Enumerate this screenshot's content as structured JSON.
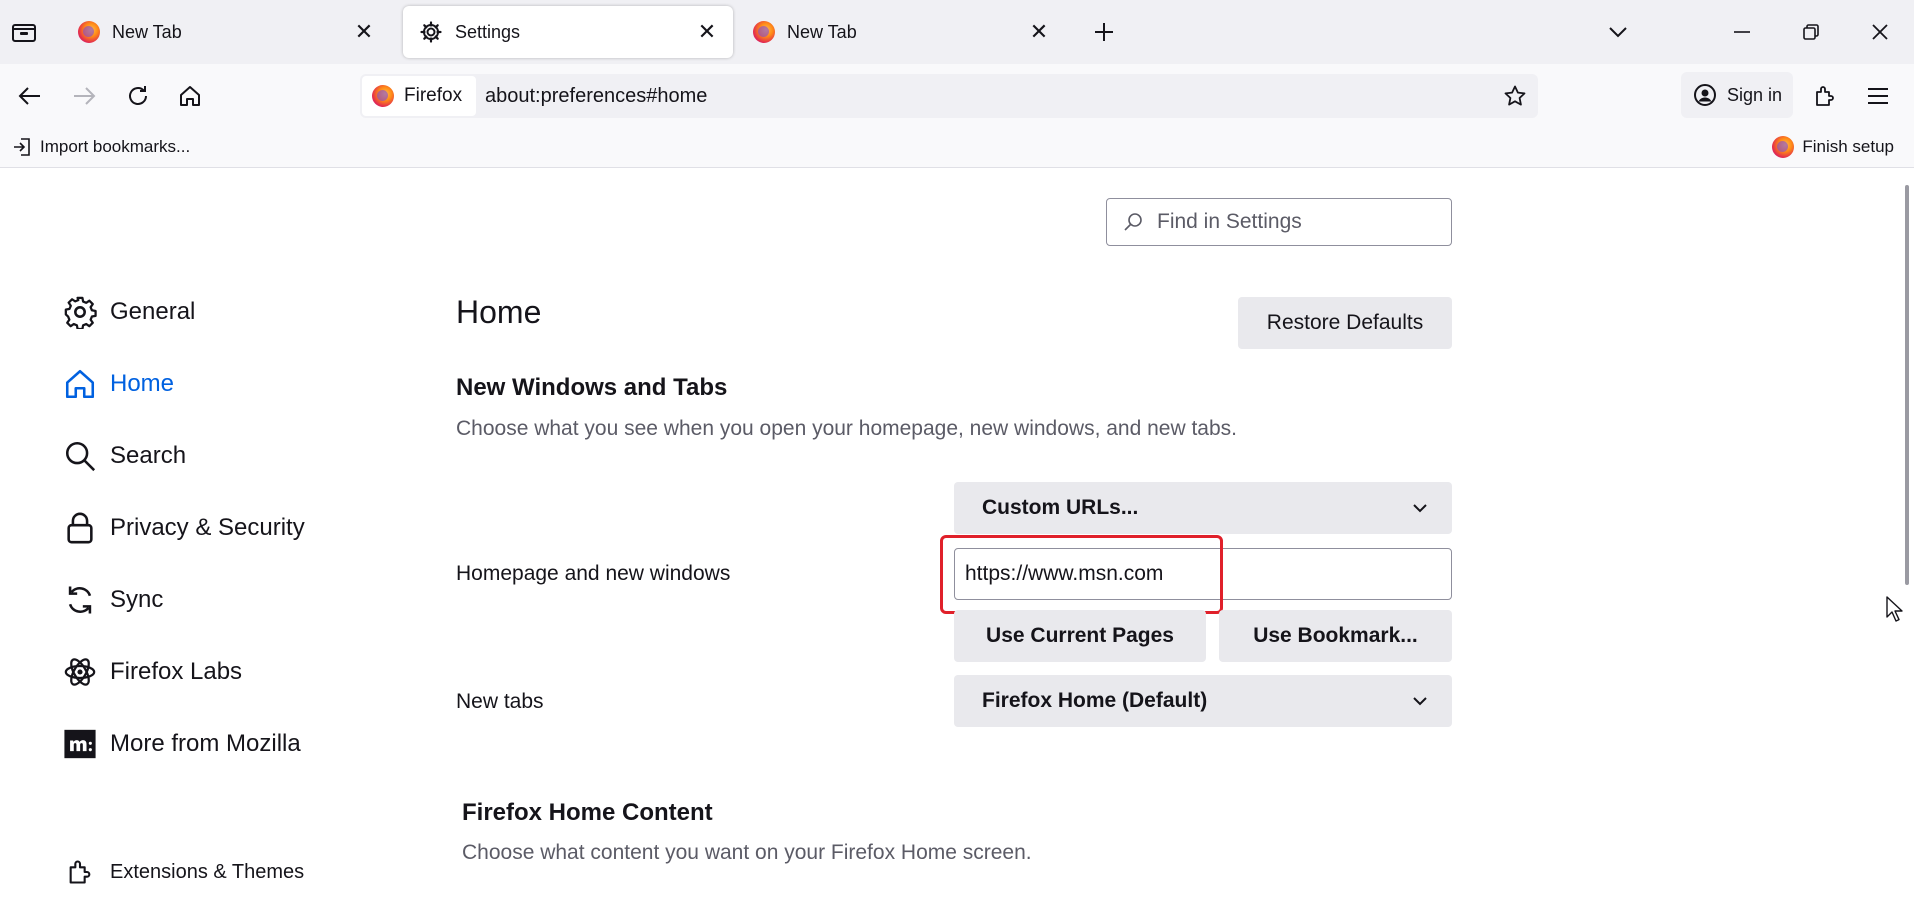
{
  "tabs": [
    {
      "label": "New Tab",
      "icon": "firefox-logo-icon",
      "active": false
    },
    {
      "label": "Settings",
      "icon": "gear-icon",
      "active": true
    },
    {
      "label": "New Tab",
      "icon": "firefox-logo-icon",
      "active": false
    }
  ],
  "navbar": {
    "identity_label": "Firefox",
    "url": "about:preferences#home",
    "signin_label": "Sign in"
  },
  "bookmarks": {
    "import_label": "Import bookmarks...",
    "finish_label": "Finish setup"
  },
  "search": {
    "placeholder": "Find in Settings"
  },
  "sidebar": {
    "items": [
      {
        "label": "General",
        "icon": "gear-icon"
      },
      {
        "label": "Home",
        "icon": "home-icon",
        "selected": true
      },
      {
        "label": "Search",
        "icon": "search-icon"
      },
      {
        "label": "Privacy & Security",
        "icon": "lock-icon"
      },
      {
        "label": "Sync",
        "icon": "sync-icon"
      },
      {
        "label": "Firefox Labs",
        "icon": "atom-icon"
      },
      {
        "label": "More from Mozilla",
        "icon": "mozilla-m-icon"
      }
    ],
    "footer_label": "Extensions & Themes"
  },
  "main": {
    "title": "Home",
    "restore_label": "Restore Defaults",
    "section1_title": "New Windows and Tabs",
    "section1_desc": "Choose what you see when you open your homepage, new windows, and new tabs.",
    "homepage_mode": "Custom URLs...",
    "homepage_label": "Homepage and new windows",
    "homepage_url": "https://www.msn.com",
    "use_current_label": "Use Current Pages",
    "use_bookmark_label": "Use Bookmark...",
    "newtabs_label": "New tabs",
    "newtabs_value": "Firefox Home (Default)",
    "section2_title": "Firefox Home Content",
    "section2_desc": "Choose what content you want on your Firefox Home screen."
  },
  "colors": {
    "accent": "#0061e0",
    "highlight": "#e0202a",
    "chrome_bg": "#f0f0f4"
  }
}
